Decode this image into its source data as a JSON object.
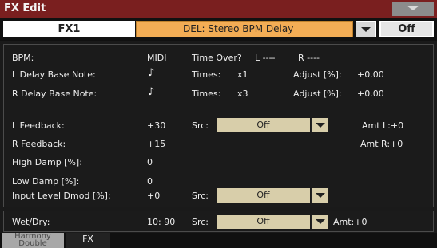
{
  "window": {
    "title": "FX Edit"
  },
  "header": {
    "fx_tab": "FX1",
    "preset": "DEL: Stereo BPM Delay",
    "off_label": "Off"
  },
  "params": {
    "bpm_label": "BPM:",
    "bpm_value": "MIDI",
    "time_over_label": "Time Over?",
    "time_over_l": "L ----",
    "time_over_r": "R ----",
    "l_delay_label": "L Delay  Base Note:",
    "l_delay_note": "♪",
    "l_times_label": "Times:",
    "l_times_value": "x1",
    "l_adjust_label": "Adjust [%]:",
    "l_adjust_value": "+0.00",
    "r_delay_label": "R Delay  Base Note:",
    "r_delay_note": "♪",
    "r_times_label": "Times:",
    "r_times_value": "x3",
    "r_adjust_label": "Adjust [%]:",
    "r_adjust_value": "+0.00",
    "l_feedback_label": "L Feedback:",
    "l_feedback_value": "+30",
    "src_label": "Src:",
    "src_value": "Off",
    "amt_l": "Amt L:+0",
    "r_feedback_label": "R Feedback:",
    "r_feedback_value": "+15",
    "amt_r": "Amt R:+0",
    "high_damp_label": "High Damp [%]:",
    "high_damp_value": "0",
    "low_damp_label": "Low Damp [%]:",
    "low_damp_value": "0",
    "input_level_label": "Input Level Dmod [%]:",
    "input_level_value": "+0",
    "input_src_value": "Off"
  },
  "wetdry": {
    "label": "Wet/Dry:",
    "value": "10: 90",
    "src_label": "Src:",
    "src_value": "Off",
    "amt": "Amt:+0"
  },
  "tabs": {
    "inactive_line1": "Harmony",
    "inactive_line2": "Double",
    "active": "FX"
  }
}
